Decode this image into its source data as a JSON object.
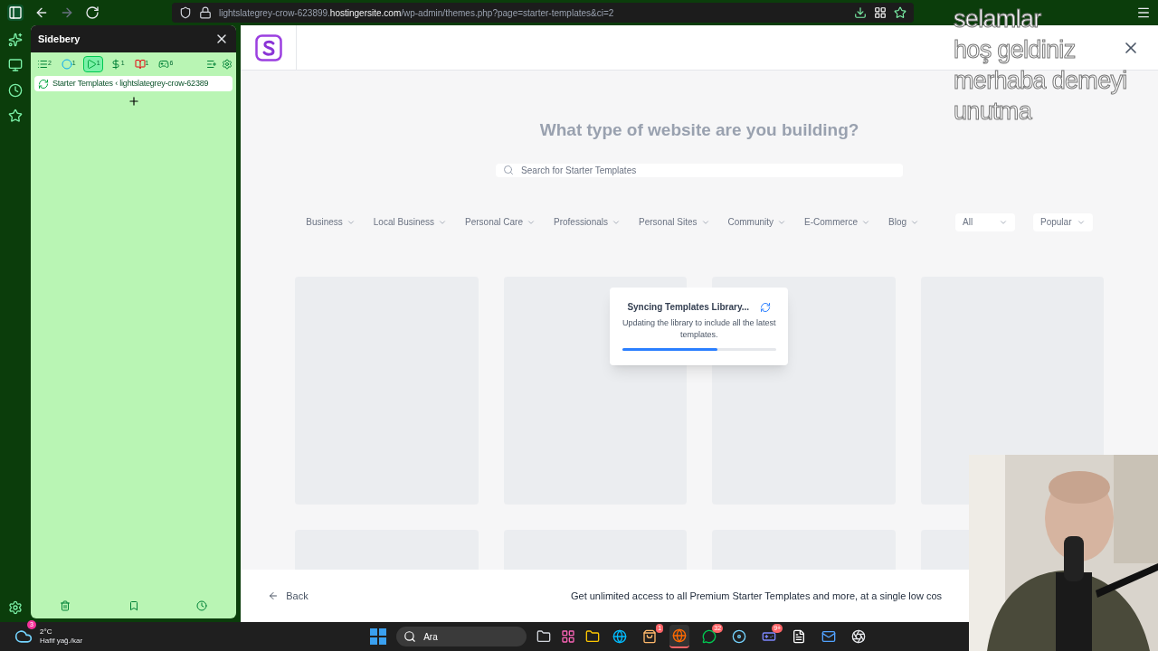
{
  "browser": {
    "url_prefix": "lightslategrey-crow-623899.",
    "url_host": "hostingersite.com",
    "url_path": "/wp-admin/themes.php?page=starter-templates&ci=2"
  },
  "sidebery": {
    "title": "Sidebery",
    "panels": [
      {
        "kind": "list",
        "count": "2",
        "selected": false
      },
      {
        "kind": "circle",
        "count": "1",
        "selected": false
      },
      {
        "kind": "play",
        "count": "1",
        "selected": true
      },
      {
        "kind": "dollar",
        "count": "1",
        "selected": false
      },
      {
        "kind": "book",
        "count": "1",
        "selected": false
      },
      {
        "kind": "gamepad",
        "count": "6",
        "selected": false
      }
    ],
    "tabs": [
      {
        "title": "Starter Templates ‹ lightslategrey-crow-62389",
        "selected": true
      }
    ]
  },
  "page": {
    "heading": "What type of website are you building?",
    "search_placeholder": "Search for Starter Templates",
    "categories": [
      "Business",
      "Local Business",
      "Personal Care",
      "Professionals",
      "Personal Sites",
      "Community",
      "E-Commerce",
      "Blog"
    ],
    "filters": [
      "All",
      "Popular"
    ],
    "modal": {
      "title": "Syncing Templates Library...",
      "text": "Updating the library to include all the latest templates.",
      "level": 0.62
    },
    "back": "Back",
    "promo": "Get unlimited access to all Premium Starter Templates and more, at a single low cos"
  },
  "stream_overlay": [
    "selamlar",
    "hoş geldiniz",
    "merhaba demeyi",
    "unutma"
  ],
  "taskbar": {
    "weather": {
      "badge": "3",
      "temp": "2°C",
      "desc": "Hafif yağ./kar"
    },
    "search": "Ara",
    "apps": [
      {
        "kind": "windows",
        "active": false
      },
      {
        "kind": "store",
        "badge": "1",
        "active": false
      },
      {
        "kind": "firefox",
        "active": true
      },
      {
        "kind": "whatsapp",
        "badge": "32",
        "active": false
      },
      {
        "kind": "steam",
        "active": false
      },
      {
        "kind": "discord",
        "badge": "9+",
        "active": false
      },
      {
        "kind": "notes",
        "active": false
      },
      {
        "kind": "thunderbird",
        "active": false
      },
      {
        "kind": "obs",
        "active": false
      }
    ]
  }
}
